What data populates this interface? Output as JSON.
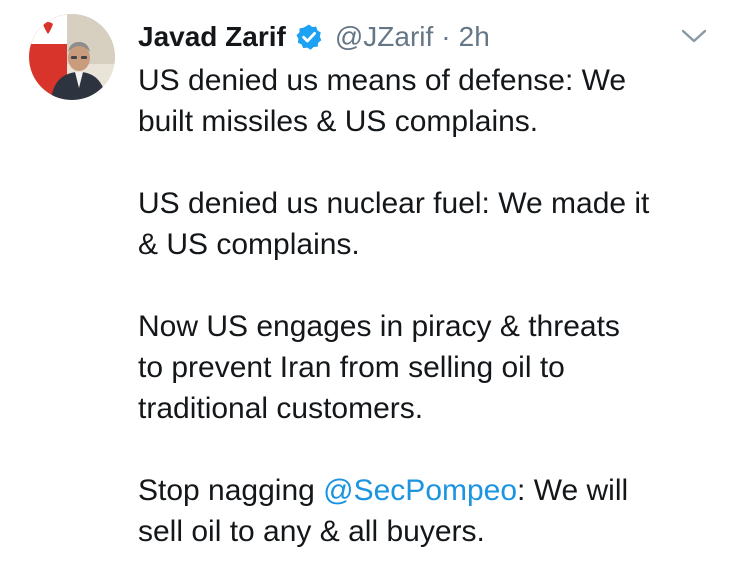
{
  "tweet": {
    "author": {
      "display_name": "Javad Zarif",
      "handle": "@JZarif",
      "verified": true,
      "avatar_icon": "profile-photo"
    },
    "separator": "·",
    "timestamp": "2h",
    "menu_icon": "chevron-down-icon",
    "paragraphs": [
      {
        "lines": [
          "US denied us means of defense: We",
          "built missiles & US complains."
        ]
      },
      {
        "lines": [
          "US denied us nuclear fuel: We made it",
          "& US complains."
        ]
      },
      {
        "lines": [
          "Now US engages in piracy & threats",
          "to prevent Iran from selling oil to",
          "traditional customers."
        ]
      }
    ],
    "last_paragraph": {
      "prefix": "Stop nagging ",
      "mention": "@SecPompeo",
      "suffix": ": We will",
      "line2": "sell oil to any & all buyers."
    }
  },
  "colors": {
    "text": "#14171a",
    "secondary": "#657786",
    "link": "#1b95e0",
    "verified_badge": "#1da1f2",
    "background": "#ffffff"
  }
}
